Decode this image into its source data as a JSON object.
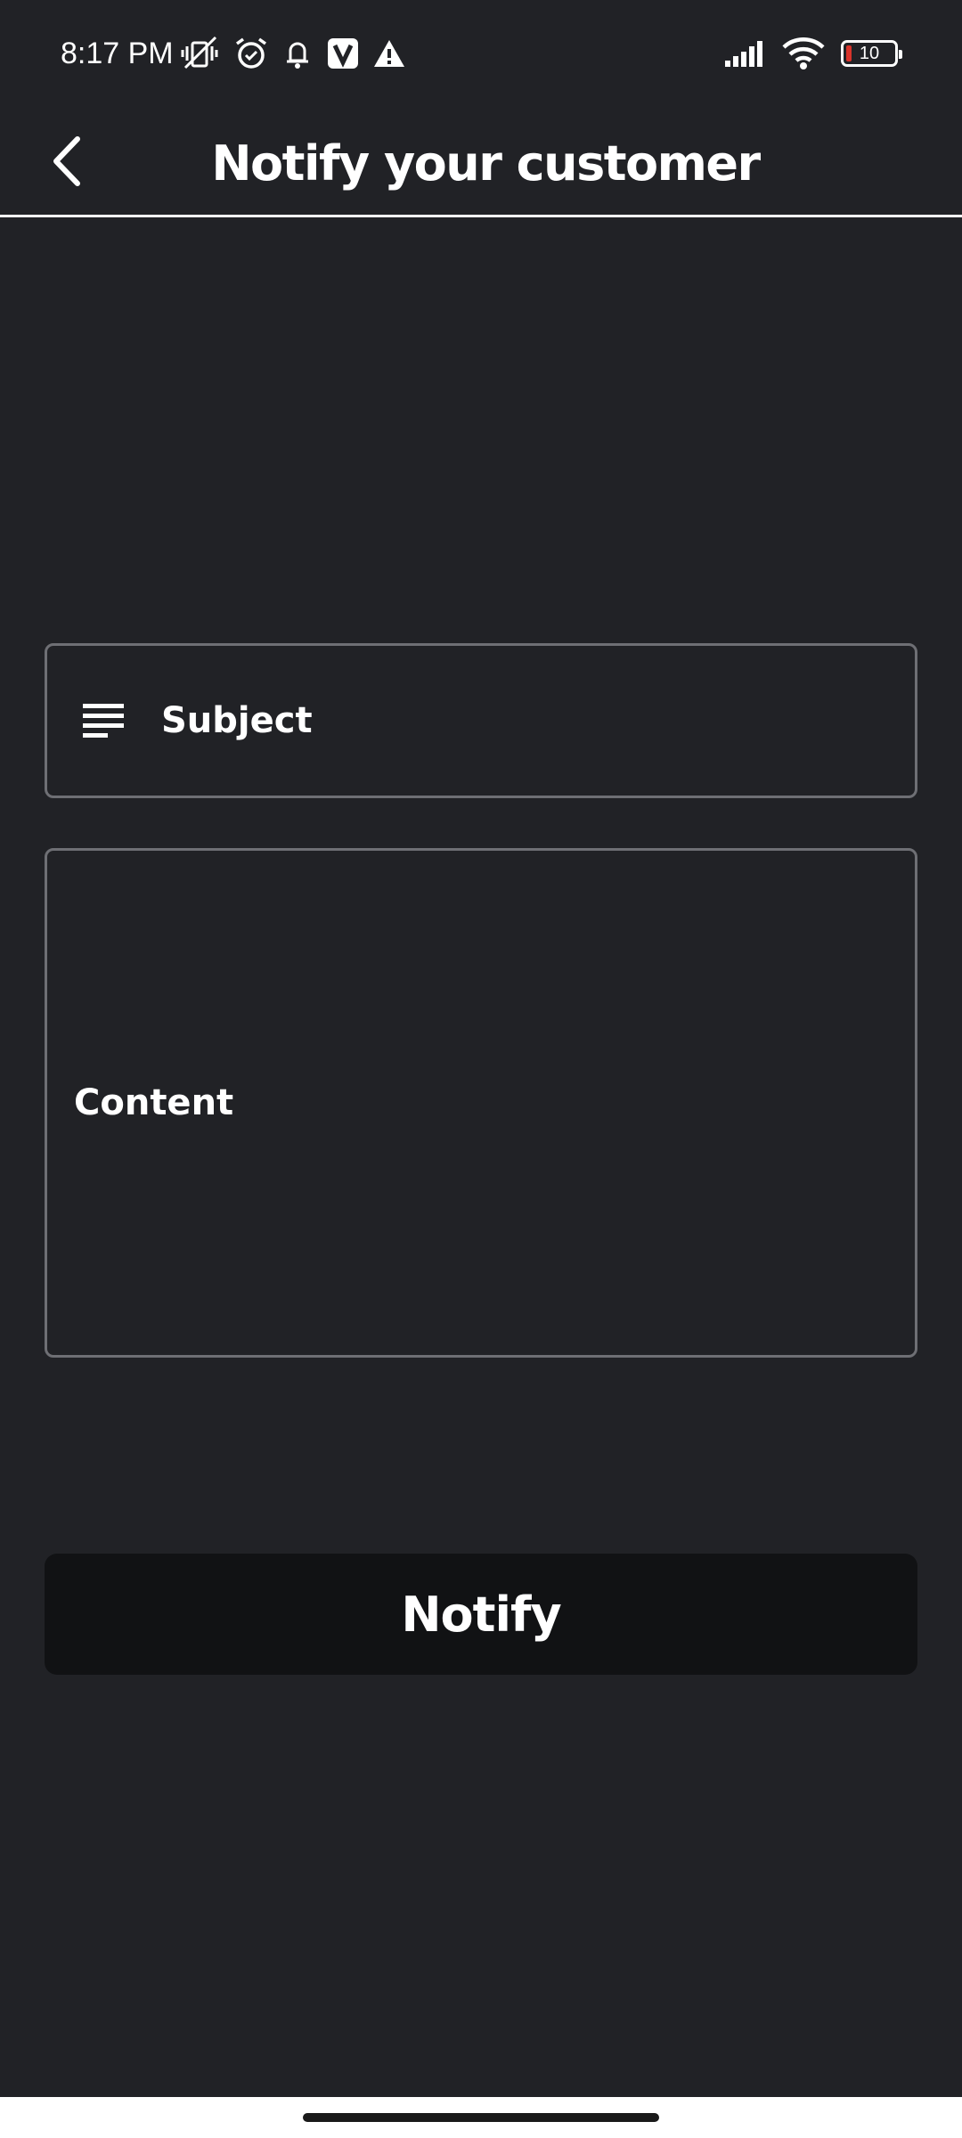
{
  "status_bar": {
    "time": "8:17 PM",
    "battery_level": "10",
    "icons": [
      "vibrate-off-icon",
      "alarm-icon",
      "notification-bell-icon",
      "v-app-icon",
      "warning-icon",
      "signal-icon",
      "wifi-icon",
      "battery-icon"
    ],
    "battery_low_color": "#d9342b"
  },
  "header": {
    "title": "Notify your customer",
    "back_icon": "chevron-left-icon"
  },
  "form": {
    "subject": {
      "placeholder": "Subject",
      "icon": "subject-lines-icon"
    },
    "content": {
      "placeholder": "Content"
    },
    "notify_label": "Notify"
  },
  "colors": {
    "background": "#212226",
    "button_background": "#111214",
    "field_border": "#6e6f74",
    "text": "#ffffff"
  }
}
